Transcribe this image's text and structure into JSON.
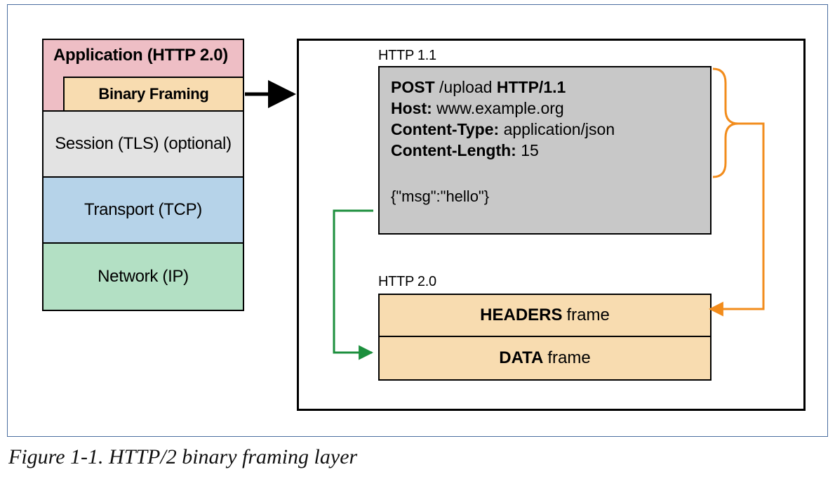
{
  "caption": "Figure 1-1. HTTP/2 binary framing layer",
  "stack": {
    "application": {
      "title": "Application (HTTP 2.0)",
      "sublayer": "Binary Framing"
    },
    "session": "Session (TLS) (optional)",
    "transport": "Transport (TCP)",
    "network": "Network (IP)"
  },
  "right": {
    "http11_label": "HTTP 1.1",
    "http20_label": "HTTP 2.0",
    "request": {
      "method": "POST",
      "path": "/upload",
      "version": "HTTP/1.1",
      "host_k": "Host:",
      "host_v": "www.example.org",
      "ctype_k": "Content-Type:",
      "ctype_v": "application/json",
      "clen_k": "Content-Length:",
      "clen_v": "15",
      "body": "{\"msg\":\"hello\"}"
    },
    "frames": {
      "headers": "HEADERS",
      "data": "DATA",
      "suffix": "frame"
    }
  }
}
